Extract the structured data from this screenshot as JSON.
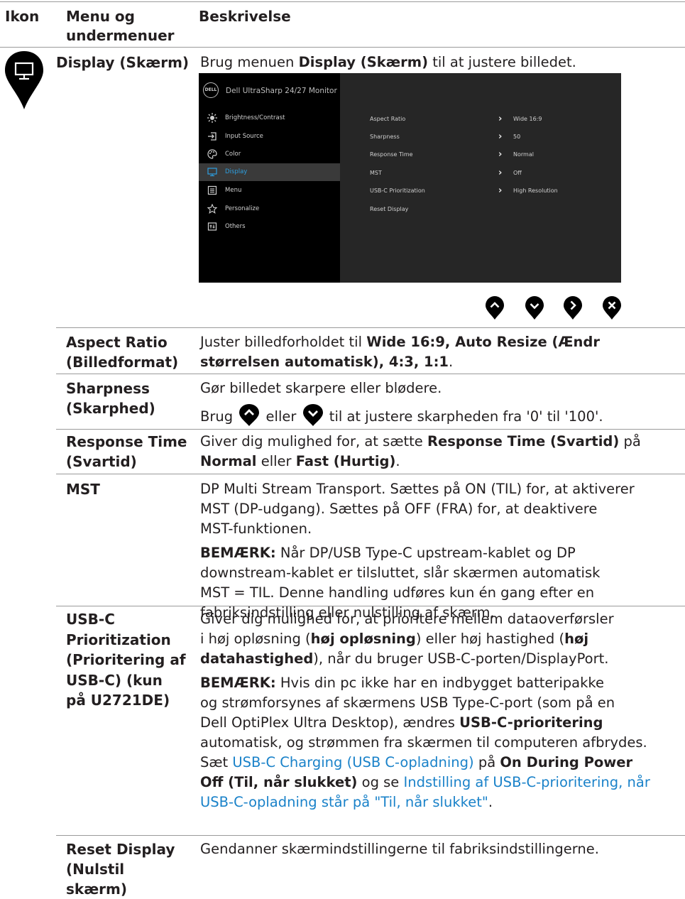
{
  "header": {
    "col1": "Ikon",
    "col2_line1": "Menu og",
    "col2_line2": "undermenuer",
    "col3": "Beskrivelse"
  },
  "display_row": {
    "label": "Display (Skærm)",
    "desc_pre": "Brug menuen ",
    "desc_bold": "Display (Skærm)",
    "desc_post": " til at justere billedet."
  },
  "osd": {
    "logo": "DELL",
    "title": "Dell UltraSharp 24/27 Monitor",
    "left_menu": [
      "Brightness/Contrast",
      "Input Source",
      "Color",
      "Display",
      "Menu",
      "Personalize",
      "Others"
    ],
    "selected": "Display",
    "right_items": [
      {
        "label": "Aspect Ratio",
        "value": "Wide 16:9"
      },
      {
        "label": "Sharpness",
        "value": "50"
      },
      {
        "label": "Response Time",
        "value": "Normal"
      },
      {
        "label": "MST",
        "value": "Off"
      },
      {
        "label": "USB-C Prioritization",
        "value": "High Resolution"
      },
      {
        "label": "Reset Display",
        "value": ""
      }
    ]
  },
  "nav_buttons": [
    "up-button-icon",
    "down-button-icon",
    "right-button-icon",
    "close-button-icon"
  ],
  "rows": {
    "aspect": {
      "label_1": "Aspect Ratio",
      "label_2": "(Billedformat)",
      "line1_pre": "Juster billedforholdet til ",
      "line1_bold": "Wide 16:9, Auto Resize (Ændr",
      "line2_bold": "størrelsen automatisk), 4:3, 1:1",
      "line2_post": "."
    },
    "sharpness": {
      "label_1": "Sharpness",
      "label_2": "(Skarphed)",
      "line1": "Gør billedet skarpere eller blødere.",
      "line2_pre": "Brug ",
      "line2_mid": " eller ",
      "line2_post": " til at justere skarpheden fra '0' til '100'."
    },
    "response": {
      "label_1": "Response Time",
      "label_2": "(Svartid)",
      "line1_pre": "Giver dig mulighed for, at sætte ",
      "line1_bold": "Response Time (Svartid)",
      "line1_post": " på",
      "line2_bold1": "Normal",
      "line2_mid": " eller ",
      "line2_bold2": "Fast (Hurtig)",
      "line2_post": "."
    },
    "mst": {
      "label_1": "MST",
      "p1_1": "DP Multi Stream Transport. Sættes på ON (TIL) for, at aktiverer",
      "p1_2": "MST (DP-udgang). Sættes på OFF (FRA) for, at deaktivere",
      "p1_3": "MST-funktionen.",
      "note_bold": "BEMÆRK:",
      "p2_1": " Når DP/USB Type-C upstream-kablet og DP",
      "p2_2": "downstream-kablet er tilsluttet, slår skærmen automatisk",
      "p2_3": "MST = TIL. Denne handling udføres kun én gang efter en",
      "p2_4": "fabriksindstilling eller nulstilling af skærm."
    },
    "usbc": {
      "label_1": "USB-C",
      "label_2": "Prioritization",
      "label_3": "(Prioritering af",
      "label_4": "USB-C) (kun",
      "label_5": "på U2721DE)",
      "a1": "Giver dig mulighed for, at prioritere mellem dataoverførsler",
      "a2_pre": "i høj opløsning (",
      "a2_bold1": "høj opløsning",
      "a2_mid": ") eller høj hastighed (",
      "a2_bold2": "høj",
      "a3_bold": "datahastighed",
      "a3_post": "), når du bruger USB-C-porten/DisplayPort.",
      "note_bold": "BEMÆRK:",
      "b1": " Hvis din pc ikke har en indbygget batteripakke",
      "b2": "og strømforsynes af skærmens USB Type-C-port (som på en",
      "b3_pre": "Dell OptiPlex Ultra Desktop), ændres ",
      "b3_bold": "USB-C-prioritering",
      "b4": "automatisk, og strømmen fra skærmen til computeren afbrydes.",
      "b5_pre": "Sæt ",
      "b5_link": "USB-C Charging (USB C-opladning) ",
      "b5_mid": " på ",
      "b5_bold": "On During Power",
      "b6_bold": "Off (Til, når slukket)",
      "b6_mid": " og se ",
      "b6_link": "Indstilling af USB-C-prioritering, når",
      "b7_link": "USB-C-opladning står på \"Til, når slukket\"",
      "b7_post": "."
    },
    "reset": {
      "label_1": "Reset Display",
      "label_2": "(Nulstil",
      "label_3": "skærm)",
      "line1": "Gendanner skærmindstillingerne til fabriksindstillingerne."
    }
  },
  "colors": {
    "text": "#231f20",
    "link": "#1a82c9",
    "rule": "#9a9a9a",
    "osd_bg": "#262626",
    "osd_left": "#000000",
    "osd_accent": "#2d9fe0"
  }
}
